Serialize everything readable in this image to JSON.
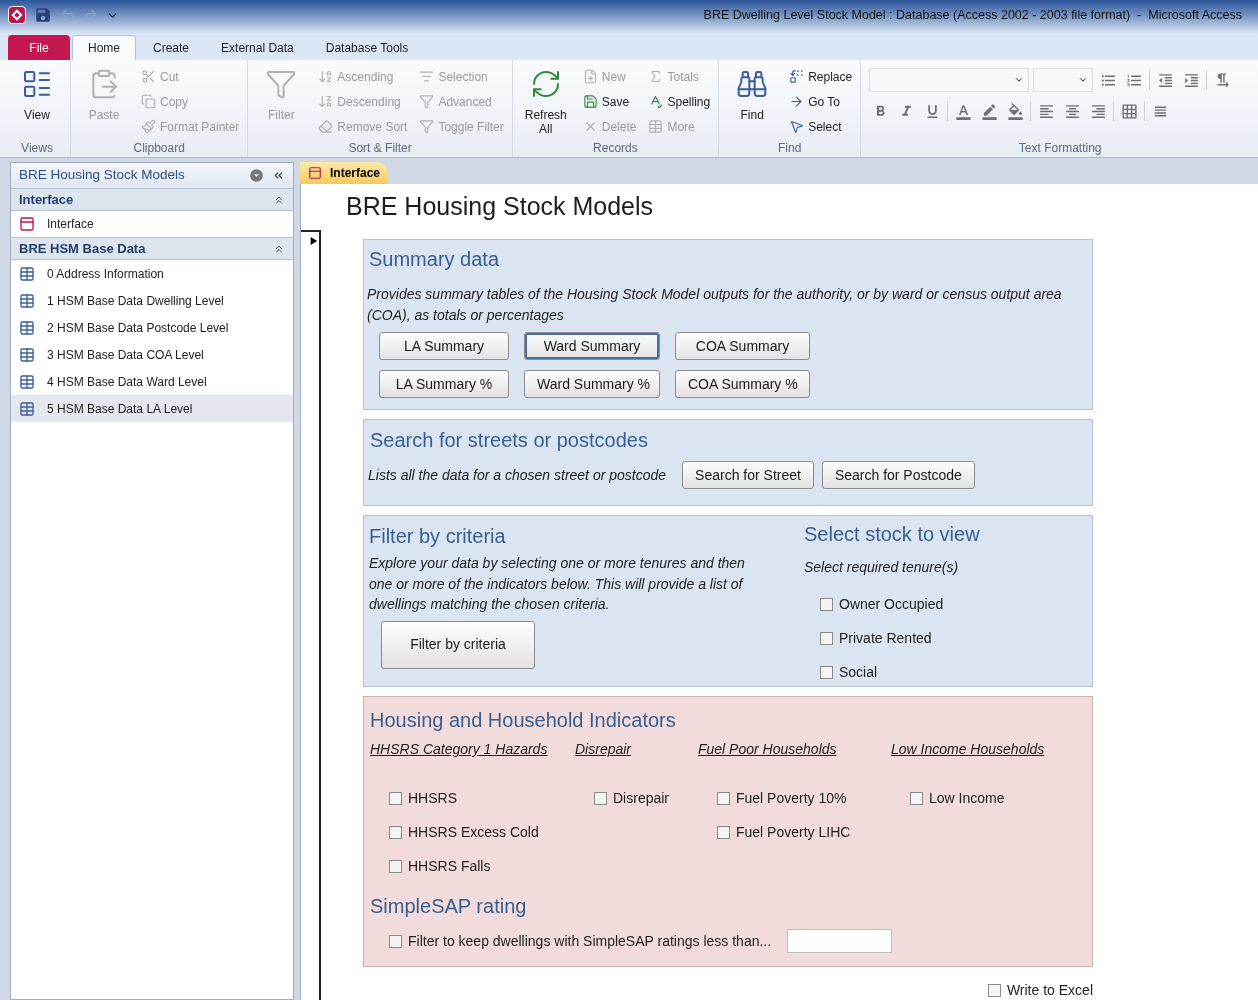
{
  "title_bar": {
    "title": "BRE Dwelling Level Stock Model : Database (Access 2002 - 2003 file format)  -  Microsoft Access"
  },
  "ribbon_tabs": [
    {
      "label": "File",
      "kind": "file",
      "selected": false
    },
    {
      "label": "Home",
      "kind": "tab",
      "selected": true
    },
    {
      "label": "Create",
      "kind": "tab",
      "selected": false
    },
    {
      "label": "External Data",
      "kind": "tab",
      "selected": false
    },
    {
      "label": "Database Tools",
      "kind": "tab",
      "selected": false
    }
  ],
  "ribbon_groups": [
    {
      "label": "Views",
      "kind": "buttons",
      "items": [
        {
          "label": "View",
          "kind": "large",
          "disabled": false
        }
      ]
    },
    {
      "label": "Clipboard",
      "kind": "buttons",
      "items": [
        {
          "label": "Paste",
          "kind": "large",
          "disabled": true
        },
        {
          "label": "Cut",
          "kind": "small",
          "disabled": true
        },
        {
          "label": "Copy",
          "kind": "small",
          "disabled": true
        },
        {
          "label": "Format Painter",
          "kind": "small",
          "disabled": true
        }
      ]
    },
    {
      "label": "Sort & Filter",
      "kind": "buttons",
      "items": [
        {
          "label": "Filter",
          "kind": "large",
          "disabled": true
        },
        {
          "label": "Ascending",
          "kind": "small",
          "disabled": true
        },
        {
          "label": "Descending",
          "kind": "small",
          "disabled": true
        },
        {
          "label": "Remove Sort",
          "kind": "small",
          "disabled": true
        },
        {
          "label": "Selection",
          "kind": "small",
          "disabled": true
        },
        {
          "label": "Advanced",
          "kind": "small",
          "disabled": true
        },
        {
          "label": "Toggle Filter",
          "kind": "small",
          "disabled": true
        }
      ]
    },
    {
      "label": "Records",
      "kind": "buttons",
      "items": [
        {
          "label": "Refresh All",
          "kind": "large",
          "disabled": false
        },
        {
          "label": "New",
          "kind": "small",
          "disabled": true
        },
        {
          "label": "Save",
          "kind": "small",
          "disabled": false
        },
        {
          "label": "Delete",
          "kind": "small",
          "disabled": true
        },
        {
          "label": "Totals",
          "kind": "small",
          "disabled": true
        },
        {
          "label": "Spelling",
          "kind": "small",
          "disabled": false
        },
        {
          "label": "More",
          "kind": "small",
          "disabled": true
        }
      ]
    },
    {
      "label": "Find",
      "kind": "buttons",
      "items": [
        {
          "label": "Find",
          "kind": "large",
          "disabled": false
        },
        {
          "label": "Replace",
          "kind": "small",
          "disabled": false
        },
        {
          "label": "Go To",
          "kind": "small",
          "disabled": false
        },
        {
          "label": "Select",
          "kind": "small",
          "disabled": false
        }
      ]
    },
    {
      "label": "Text Formatting",
      "kind": "formatting"
    }
  ],
  "nav_pane": {
    "title": "BRE Housing Stock Models",
    "groups": [
      {
        "label": "Interface",
        "expanded": true,
        "items": [
          {
            "label": "Interface",
            "kind": "form",
            "selected": false
          }
        ]
      },
      {
        "label": "BRE HSM Base Data",
        "expanded": true,
        "items": [
          {
            "label": "0 Address Information",
            "kind": "table",
            "selected": false
          },
          {
            "label": "1 HSM Base Data Dwelling Level",
            "kind": "table",
            "selected": false
          },
          {
            "label": "2 HSM Base Data Postcode Level",
            "kind": "table",
            "selected": false
          },
          {
            "label": "3 HSM Base Data COA Level",
            "kind": "table",
            "selected": false
          },
          {
            "label": "4 HSM Base Data Ward Level",
            "kind": "table",
            "selected": false
          },
          {
            "label": "5 HSM Base Data LA Level",
            "kind": "table",
            "selected": true
          }
        ]
      }
    ]
  },
  "document_tab": {
    "label": "Interface",
    "selected": true
  },
  "form": {
    "title": "BRE Housing Stock Models",
    "summary": {
      "heading": "Summary data",
      "description": "Provides summary tables of the Housing Stock Model outputs for the authority, or by ward or census output area (COA), as totals or percentages",
      "buttons": [
        {
          "label": "LA Summary",
          "focused": false
        },
        {
          "label": "Ward Summary",
          "focused": true
        },
        {
          "label": "COA Summary",
          "focused": false
        },
        {
          "label": "LA Summary %",
          "focused": false
        },
        {
          "label": "Ward Summary %",
          "focused": false
        },
        {
          "label": "COA Summary %",
          "focused": false
        }
      ]
    },
    "search": {
      "heading": "Search for streets or postcodes",
      "description": "Lists all the data for a chosen street or postcode",
      "buttons": [
        {
          "label": "Search for Street"
        },
        {
          "label": "Search for Postcode"
        }
      ]
    },
    "filter": {
      "heading": "Filter by criteria",
      "description": "Explore your data by selecting one or more tenures and then one or more of the indicators below.  This will provide a list of dwellings matching the chosen criteria.",
      "button": "Filter by criteria"
    },
    "tenure": {
      "heading": "Select stock to view",
      "prompt": "Select required tenure(s)",
      "options": [
        {
          "label": "Owner Occupied",
          "checked": false
        },
        {
          "label": "Private Rented",
          "checked": false
        },
        {
          "label": "Social",
          "checked": false
        }
      ]
    },
    "indicators": {
      "heading": "Housing and Household Indicators",
      "columns": [
        {
          "heading": "HHSRS Category 1 Hazards",
          "options": [
            {
              "label": "HHSRS",
              "checked": false
            },
            {
              "label": "HHSRS Excess Cold",
              "checked": false
            },
            {
              "label": "HHSRS Falls",
              "checked": false
            }
          ]
        },
        {
          "heading": "Disrepair",
          "options": [
            {
              "label": "Disrepair",
              "checked": false
            }
          ]
        },
        {
          "heading": "Fuel Poor Households",
          "options": [
            {
              "label": "Fuel Poverty 10%",
              "checked": false
            },
            {
              "label": "Fuel Poverty LIHC",
              "checked": false
            }
          ]
        },
        {
          "heading": "Low Income Households",
          "options": [
            {
              "label": "Low Income",
              "checked": false
            }
          ]
        }
      ]
    },
    "simplesap": {
      "heading": "SimpleSAP rating",
      "option": {
        "label": "Filter to keep dwellings with SimpleSAP ratings less than...",
        "checked": false
      }
    },
    "write_to_excel": {
      "label": "Write to Excel",
      "checked": false
    }
  }
}
